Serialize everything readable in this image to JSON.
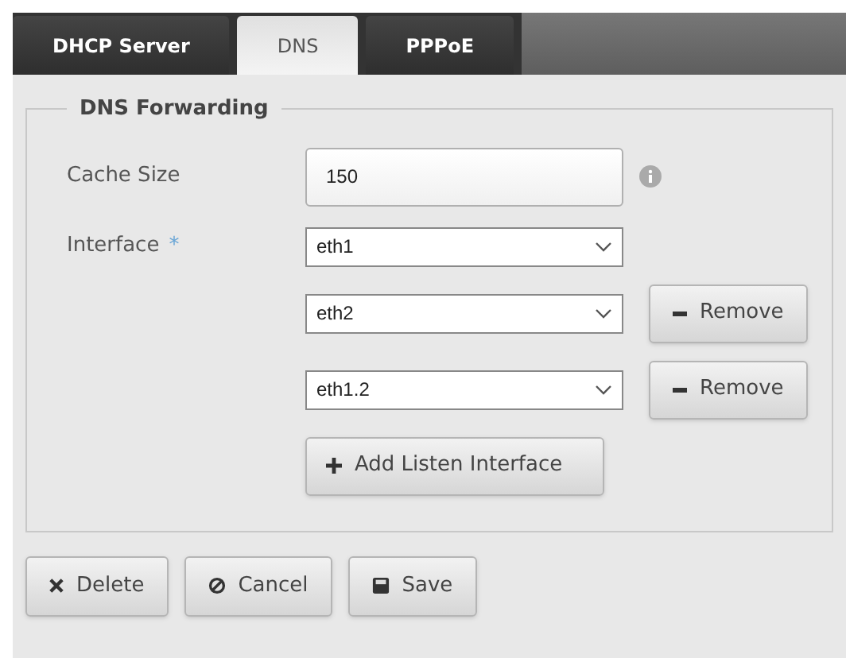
{
  "tabs": [
    {
      "label": "DHCP Server",
      "selected": false
    },
    {
      "label": "DNS",
      "selected": true
    },
    {
      "label": "PPPoE",
      "selected": false
    }
  ],
  "section": {
    "title": "DNS Forwarding",
    "cache_size": {
      "label": "Cache Size",
      "value": "150"
    },
    "interface": {
      "label": "Interface",
      "required_mark": "*",
      "entries": [
        {
          "value": "eth1",
          "removable": false
        },
        {
          "value": "eth2",
          "removable": true,
          "remove_label": "Remove"
        },
        {
          "value": "eth1.2",
          "removable": true,
          "remove_label": "Remove"
        }
      ],
      "add_label": "Add Listen Interface"
    }
  },
  "actions": [
    {
      "kind": "delete",
      "label": "Delete"
    },
    {
      "kind": "cancel",
      "label": "Cancel"
    },
    {
      "kind": "save",
      "label": "Save"
    }
  ]
}
